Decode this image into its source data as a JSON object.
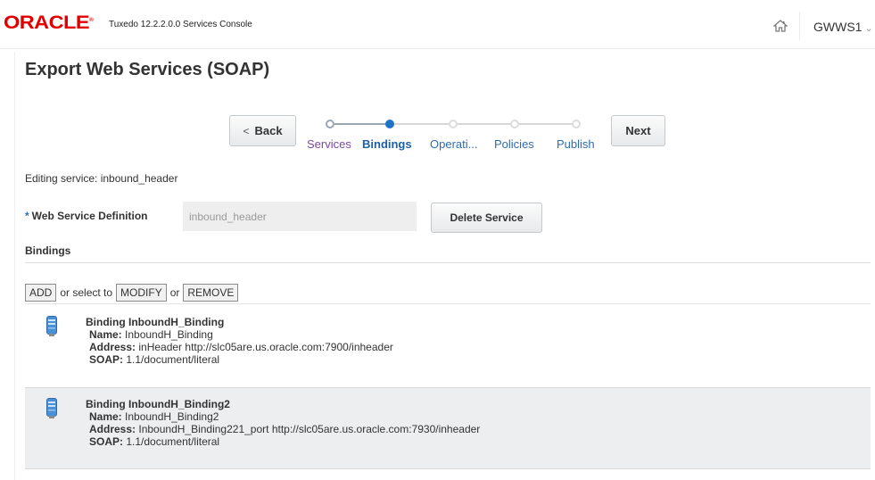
{
  "header": {
    "logo_text": "ORACLE",
    "product_title": "Tuxedo 12.2.2.0.0 Services Console",
    "username": "GWWS1",
    "brand_color": "#e00000"
  },
  "page": {
    "title": "Export Web Services (SOAP)"
  },
  "train": {
    "back_label": "Back",
    "next_label": "Next",
    "steps": [
      {
        "label": "Services",
        "state": "visited"
      },
      {
        "label": "Bindings",
        "state": "current"
      },
      {
        "label": "Operati...",
        "state": "future"
      },
      {
        "label": "Policies",
        "state": "future"
      },
      {
        "label": "Publish",
        "state": "future"
      }
    ]
  },
  "form": {
    "editing_text": "Editing service: inbound_header",
    "required_mark": "*",
    "definition_label": "Web Service Definition",
    "definition_value": "inbound_header",
    "delete_label": "Delete Service"
  },
  "bindings": {
    "section_title": "Bindings",
    "actions": {
      "add": "ADD",
      "select_text": "or select to",
      "modify": "MODIFY",
      "or_text": "or",
      "remove": "REMOVE"
    },
    "items": [
      {
        "title": "Binding InboundH_Binding",
        "name_label": "Name:",
        "name": "InboundH_Binding",
        "address_label": "Address:",
        "address": "inHeader http://slc05are.us.oracle.com:7900/inheader",
        "soap_label": "SOAP:",
        "soap": "1.1/document/literal"
      },
      {
        "title": "Binding InboundH_Binding2",
        "name_label": "Name:",
        "name": "InboundH_Binding2",
        "address_label": "Address:",
        "address": "InboundH_Binding221_port http://slc05are.us.oracle.com:7930/inheader",
        "soap_label": "SOAP:",
        "soap": "1.1/document/literal"
      }
    ]
  }
}
